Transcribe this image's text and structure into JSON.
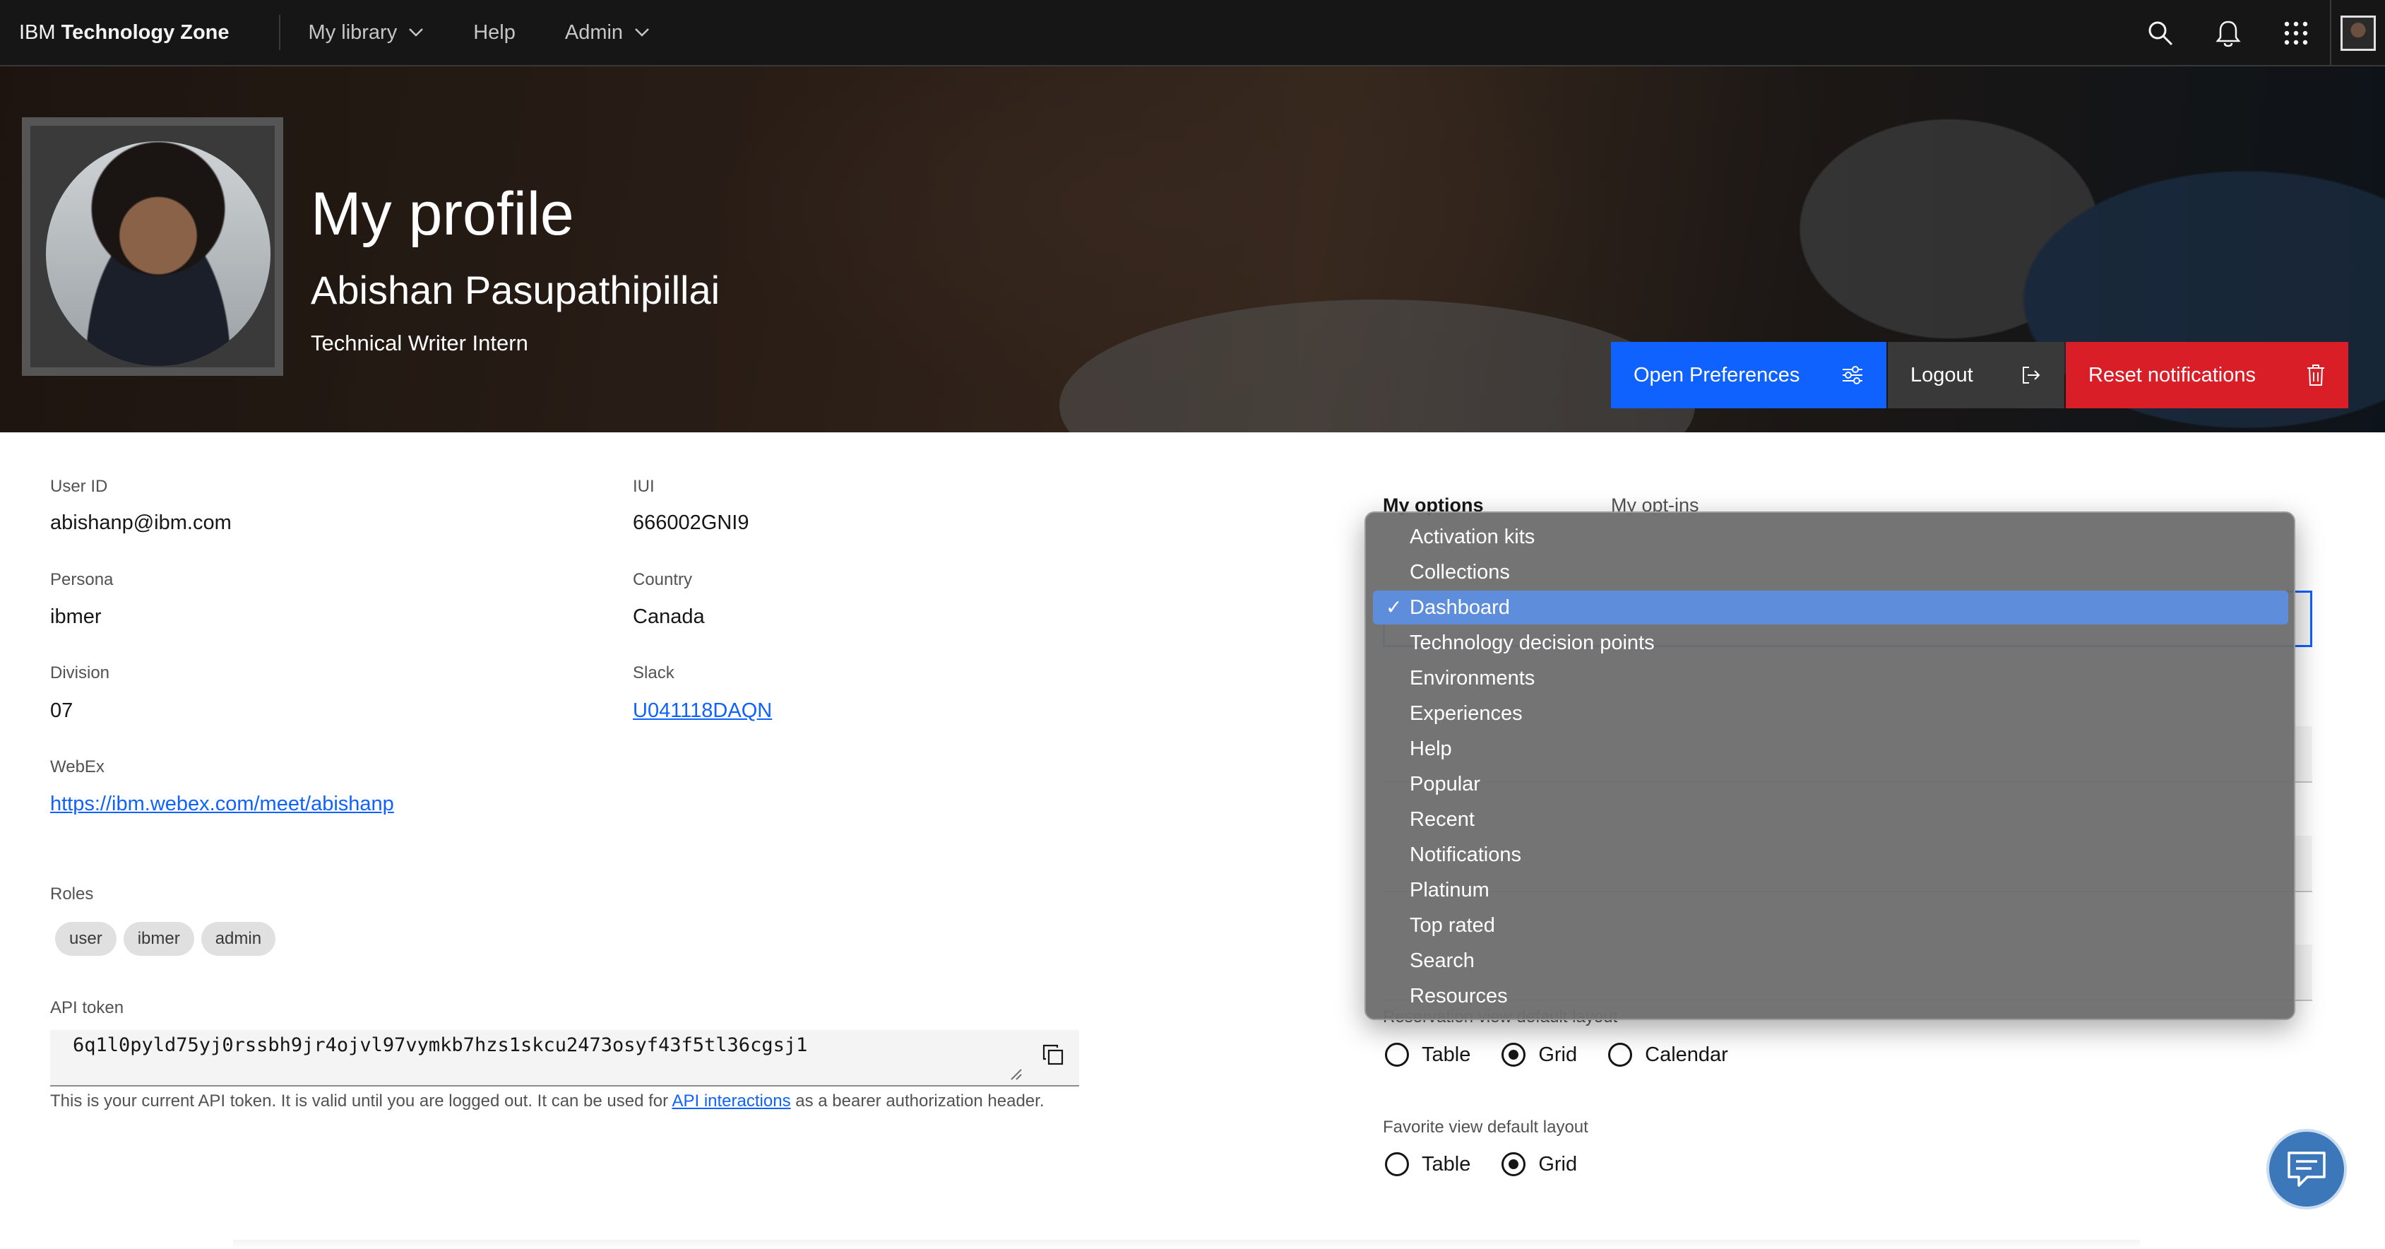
{
  "nav": {
    "brand_prefix": "IBM",
    "brand_bold": "Technology Zone",
    "items": [
      {
        "label": "My library",
        "has_chevron": true
      },
      {
        "label": "Help",
        "has_chevron": false
      },
      {
        "label": "Admin",
        "has_chevron": true
      }
    ],
    "icons": [
      "search-icon",
      "notification-icon",
      "app-switcher-icon",
      "user-avatar"
    ]
  },
  "hero": {
    "title": "My profile",
    "name": "Abishan Pasupathipillai",
    "role": "Technical Writer Intern",
    "buttons": {
      "preferences": "Open Preferences",
      "logout": "Logout",
      "reset": "Reset notifications"
    }
  },
  "profile": {
    "user_id_label": "User ID",
    "user_id": "abishanp@ibm.com",
    "iui_label": "IUI",
    "iui": "666002GNI9",
    "persona_label": "Persona",
    "persona": "ibmer",
    "country_label": "Country",
    "country": "Canada",
    "division_label": "Division",
    "division": "07",
    "slack_label": "Slack",
    "slack": "U041118DAQN",
    "webex_label": "WebEx",
    "webex": "https://ibm.webex.com/meet/abishanp",
    "roles_label": "Roles",
    "roles": [
      "user",
      "ibmer",
      "admin"
    ],
    "api_token_label": "API token",
    "api_token": "6q1l0pyld75yj0rssbh9jr4ojvl97vymkb7hzs1skcu2473osyf43f5tl36cgsj1",
    "helper_pre": "This is your current API token. It is valid until you are logged out. It can be used for ",
    "helper_link": "API interactions",
    "helper_post": " as a bearer authorization header."
  },
  "options": {
    "tabs": [
      "My options",
      "My opt-ins"
    ],
    "dropdown_items": [
      "Activation kits",
      "Collections",
      "Dashboard",
      "Technology decision points",
      "Environments",
      "Experiences",
      "Help",
      "Popular",
      "Recent",
      "Notifications",
      "Platinum",
      "Top rated",
      "Search",
      "Resources"
    ],
    "dropdown_selected": "Dashboard",
    "check_mark": "✓",
    "reservation_label": "Reservation view default layout",
    "reservation_options": [
      "Table",
      "Grid",
      "Calendar"
    ],
    "reservation_selected": "Grid",
    "favorite_label": "Favorite view default layout",
    "favorite_options": [
      "Table",
      "Grid"
    ],
    "favorite_selected": "Grid"
  },
  "colors": {
    "primary": "#0f62fe",
    "danger": "#da1e28",
    "nav_bg": "#161616",
    "menu_highlight": "#5d8ddb",
    "chat_fab": "#3b77b9"
  }
}
